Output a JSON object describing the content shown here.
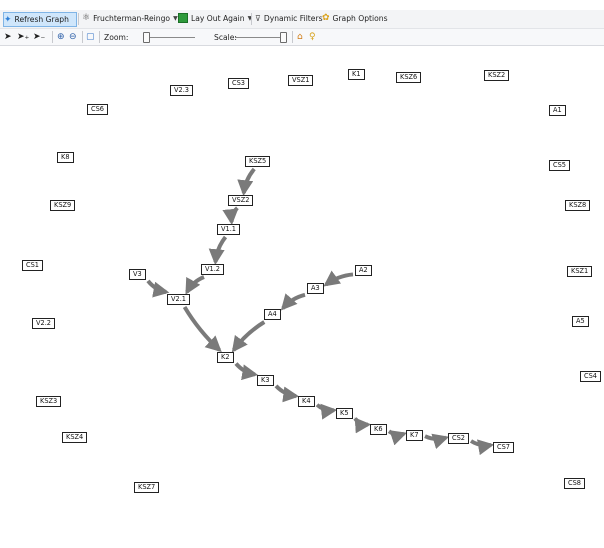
{
  "toolbar_top": {
    "refresh_label": "Refresh Graph",
    "layout_select": "Fruchterman-Reingo",
    "layout_again_label": "Lay Out Again",
    "filters_label": "Dynamic Filters",
    "options_label": "Graph Options"
  },
  "toolbar_bottom": {
    "zoom_label": "Zoom:",
    "scale_label": "Scale:",
    "zoom_level": 0.05,
    "scale_level": 0.95
  },
  "graph": {
    "nodes": [
      {
        "id": "V2.3",
        "label": "V2.3"
      },
      {
        "id": "CS3",
        "label": "CS3"
      },
      {
        "id": "VSZ1",
        "label": "VSZ1"
      },
      {
        "id": "K1",
        "label": "K1"
      },
      {
        "id": "KSZ6",
        "label": "KSZ6"
      },
      {
        "id": "KSZ2",
        "label": "KSZ2"
      },
      {
        "id": "CS6",
        "label": "CS6"
      },
      {
        "id": "A1",
        "label": "A1"
      },
      {
        "id": "K8",
        "label": "K8"
      },
      {
        "id": "KSZ5",
        "label": "KSZ5"
      },
      {
        "id": "CS5",
        "label": "CS5"
      },
      {
        "id": "VSZ2",
        "label": "VSZ2"
      },
      {
        "id": "KSZ9",
        "label": "KSZ9"
      },
      {
        "id": "KSZ8",
        "label": "KSZ8"
      },
      {
        "id": "V1.1",
        "label": "V1.1"
      },
      {
        "id": "CS1",
        "label": "CS1"
      },
      {
        "id": "V1.2",
        "label": "V1.2"
      },
      {
        "id": "A2",
        "label": "A2"
      },
      {
        "id": "KSZ1",
        "label": "KSZ1"
      },
      {
        "id": "V3",
        "label": "V3"
      },
      {
        "id": "A3",
        "label": "A3"
      },
      {
        "id": "V2.1",
        "label": "V2.1"
      },
      {
        "id": "A4",
        "label": "A4"
      },
      {
        "id": "V2.2",
        "label": "V2.2"
      },
      {
        "id": "A5",
        "label": "A5"
      },
      {
        "id": "K2",
        "label": "K2"
      },
      {
        "id": "K3",
        "label": "K3"
      },
      {
        "id": "CS4",
        "label": "CS4"
      },
      {
        "id": "KSZ3",
        "label": "KSZ3"
      },
      {
        "id": "K4",
        "label": "K4"
      },
      {
        "id": "K5",
        "label": "K5"
      },
      {
        "id": "K6",
        "label": "K6"
      },
      {
        "id": "K7",
        "label": "K7"
      },
      {
        "id": "CS2",
        "label": "CS2"
      },
      {
        "id": "KSZ4",
        "label": "KSZ4"
      },
      {
        "id": "CS7",
        "label": "CS7"
      },
      {
        "id": "KSZ7",
        "label": "KSZ7"
      },
      {
        "id": "CS8",
        "label": "CS8"
      }
    ],
    "edges": [
      {
        "from": "KSZ5",
        "to": "VSZ2"
      },
      {
        "from": "VSZ2",
        "to": "V1.1"
      },
      {
        "from": "V1.1",
        "to": "V1.2"
      },
      {
        "from": "V1.2",
        "to": "V2.1"
      },
      {
        "from": "V3",
        "to": "V2.1"
      },
      {
        "from": "V2.1",
        "to": "K2"
      },
      {
        "from": "A2",
        "to": "A3"
      },
      {
        "from": "A3",
        "to": "A4"
      },
      {
        "from": "A4",
        "to": "K2"
      },
      {
        "from": "K2",
        "to": "K3"
      },
      {
        "from": "K3",
        "to": "K4"
      },
      {
        "from": "K4",
        "to": "K5"
      },
      {
        "from": "K5",
        "to": "K6"
      },
      {
        "from": "K6",
        "to": "K7"
      },
      {
        "from": "K7",
        "to": "CS2"
      },
      {
        "from": "CS2",
        "to": "CS7"
      }
    ],
    "edge_color": "#7a7a7a"
  },
  "colors": {
    "toolbar_bg": "#f3f4f6",
    "active_button_bg": "#cfe6fb",
    "node_border": "#222222",
    "edge": "#7a7a7a"
  }
}
